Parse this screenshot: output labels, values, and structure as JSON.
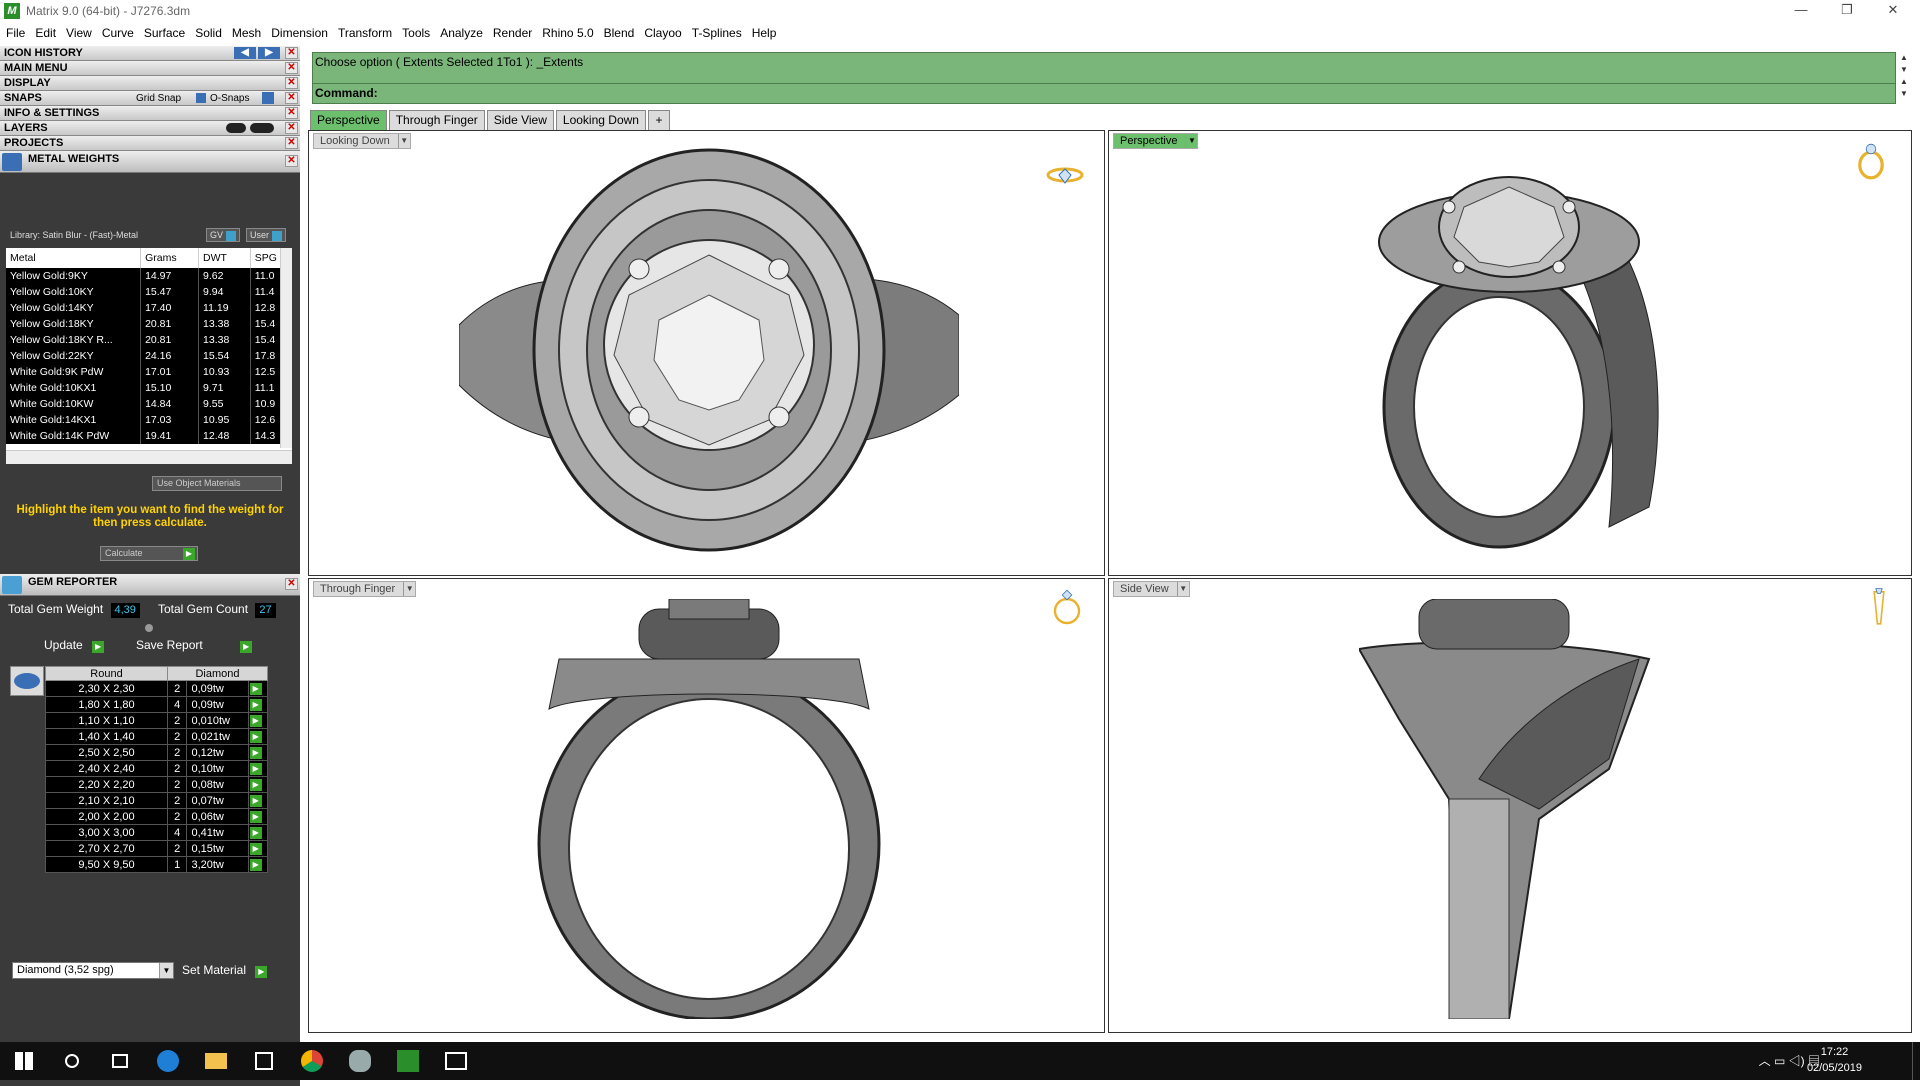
{
  "window": {
    "title": "Matrix 9.0 (64-bit) - J7276.3dm",
    "controls": [
      "—",
      "❐",
      "✕"
    ]
  },
  "menu": [
    "File",
    "Edit",
    "View",
    "Curve",
    "Surface",
    "Solid",
    "Mesh",
    "Dimension",
    "Transform",
    "Tools",
    "Analyze",
    "Render",
    "Rhino 5.0",
    "Blend",
    "Clayoo",
    "T-Splines",
    "Help"
  ],
  "sidebar": {
    "headers": [
      "ICON HISTORY",
      "MAIN MENU",
      "DISPLAY",
      "SNAPS",
      "INFO & SETTINGS",
      "LAYERS",
      "PROJECTS"
    ],
    "snaps": {
      "grid_snap": "Grid Snap",
      "o_snaps": "O-Snaps"
    },
    "close_glyph": "✕"
  },
  "metal_weights": {
    "title": "METAL WEIGHTS",
    "library": "Library: Satin Blur - (Fast)-Metal",
    "gv": "GV",
    "user": "User",
    "columns": [
      "Metal",
      "Grams",
      "DWT",
      "SPG"
    ],
    "rows": [
      [
        "Yellow Gold:9KY",
        "14.97",
        "9.62",
        "11.0"
      ],
      [
        "Yellow Gold:10KY",
        "15.47",
        "9.94",
        "11.4"
      ],
      [
        "Yellow Gold:14KY",
        "17.40",
        "11.19",
        "12.8"
      ],
      [
        "Yellow Gold:18KY",
        "20.81",
        "13.38",
        "15.4"
      ],
      [
        "Yellow Gold:18KY R...",
        "20.81",
        "13.38",
        "15.4"
      ],
      [
        "Yellow Gold:22KY",
        "24.16",
        "15.54",
        "17.8"
      ],
      [
        "White Gold:9K PdW",
        "17.01",
        "10.93",
        "12.5"
      ],
      [
        "White Gold:10KX1",
        "15.10",
        "9.71",
        "11.1"
      ],
      [
        "White Gold:10KW",
        "14.84",
        "9.55",
        "10.9"
      ],
      [
        "White Gold:14KX1",
        "17.03",
        "10.95",
        "12.6"
      ],
      [
        "White Gold:14K PdW",
        "19.41",
        "12.48",
        "14.3"
      ]
    ],
    "use_object_materials": "Use Object Materials",
    "hint": "Highlight the item you want to find the weight for then press calculate.",
    "calculate": "Calculate"
  },
  "gem_reporter": {
    "title": "GEM REPORTER",
    "total_gem_weight_label": "Total Gem Weight",
    "total_gem_weight": "4,39",
    "total_gem_count_label": "Total Gem Count",
    "total_gem_count": "27",
    "update": "Update",
    "save_report": "Save Report",
    "columns": [
      "Round",
      "Diamond"
    ],
    "rows": [
      [
        "2,30 X 2,30",
        "2",
        "0,09tw"
      ],
      [
        "1,80 X 1,80",
        "4",
        "0,09tw"
      ],
      [
        "1,10 X 1,10",
        "2",
        "0,010tw"
      ],
      [
        "1,40 X 1,40",
        "2",
        "0,021tw"
      ],
      [
        "2,50 X 2,50",
        "2",
        "0,12tw"
      ],
      [
        "2,40 X 2,40",
        "2",
        "0,10tw"
      ],
      [
        "2,20 X 2,20",
        "2",
        "0,08tw"
      ],
      [
        "2,10 X 2,10",
        "2",
        "0,07tw"
      ],
      [
        "2,00 X 2,00",
        "2",
        "0,06tw"
      ],
      [
        "3,00 X 3,00",
        "4",
        "0,41tw"
      ],
      [
        "2,70 X 2,70",
        "2",
        "0,15tw"
      ],
      [
        "9,50 X 9,50",
        "1",
        "3,20tw"
      ]
    ],
    "material": "Diamond     (3,52 spg)",
    "set_material": "Set Material"
  },
  "command": {
    "line1": "Choose option ( Extents  Selected  1To1 ): _Extents",
    "line2": "Command:"
  },
  "tabs": [
    "Perspective",
    "Through Finger",
    "Side View",
    "Looking Down",
    "+"
  ],
  "viewports": {
    "top_left": "Looking Down",
    "top_right": "Perspective",
    "bottom_left": "Through Finger",
    "bottom_right": "Side View"
  },
  "taskbar": {
    "time": "17:22",
    "date": "02/05/2019"
  },
  "colors": {
    "command_bg": "#7ab57a",
    "active_tab": "#6cbf6c",
    "panel_bg": "#3a3a3a",
    "hint": "#ffd200",
    "value": "#3fc7e8"
  }
}
